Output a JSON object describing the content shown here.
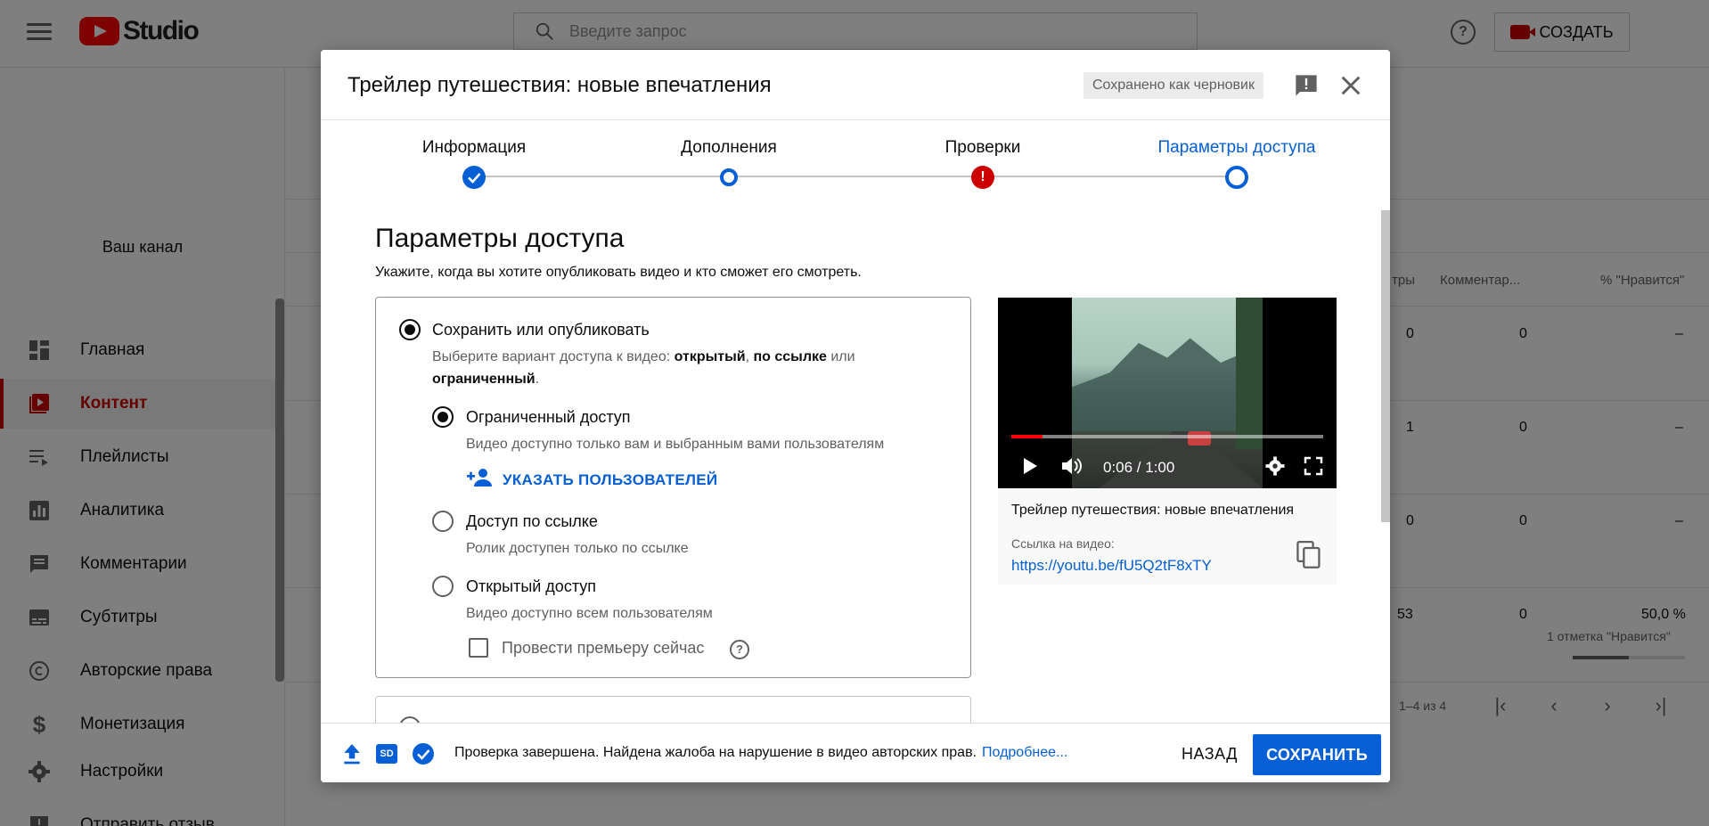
{
  "app": {
    "logo_text": "Studio",
    "search_placeholder": "Введите запрос",
    "create_label": "СОЗДАТЬ",
    "help_glyph": "?"
  },
  "sidebar": {
    "channel_label": "Ваш канал",
    "items": [
      {
        "label": "Главная",
        "icon": "dashboard-icon"
      },
      {
        "label": "Контент",
        "icon": "content-icon",
        "active": true
      },
      {
        "label": "Плейлисты",
        "icon": "playlist-icon"
      },
      {
        "label": "Аналитика",
        "icon": "analytics-icon"
      },
      {
        "label": "Комментарии",
        "icon": "comments-icon"
      },
      {
        "label": "Субтитры",
        "icon": "subtitles-icon"
      },
      {
        "label": "Авторские права",
        "icon": "copyright-icon"
      },
      {
        "label": "Монетизация",
        "icon": "dollar-icon"
      },
      {
        "label": "Настройки",
        "icon": "gear-icon"
      },
      {
        "label": "Отправить отзыв",
        "icon": "feedback-icon"
      }
    ]
  },
  "table": {
    "headers": [
      "тры",
      "Комментар...",
      "% \"Нравится\""
    ],
    "rows": [
      {
        "views": "0",
        "comments": "0",
        "likes": "–"
      },
      {
        "views": "1",
        "comments": "0",
        "likes": "–"
      },
      {
        "views": "0",
        "comments": "0",
        "likes": "–"
      },
      {
        "views": "53",
        "comments": "0",
        "likes": "50,0 %",
        "likes_sub": "1 отметка \"Нравится\"",
        "likes_ratio": 0.5
      }
    ],
    "pager_text": "1–4 из 4"
  },
  "dialog": {
    "title": "Трейлер путешествия: новые впечатления",
    "draft_badge": "Сохранено как черновик",
    "steps": [
      {
        "label": "Информация",
        "state": "done"
      },
      {
        "label": "Дополнения",
        "state": "visited"
      },
      {
        "label": "Проверки",
        "state": "error"
      },
      {
        "label": "Параметры доступа",
        "state": "current"
      }
    ],
    "section_title": "Параметры доступа",
    "section_subtitle": "Укажите, когда вы хотите опубликовать видео и кто сможет его смотреть.",
    "save_publish": {
      "title": "Сохранить или опубликовать",
      "desc_prefix": "Выберите вариант доступа к видео: ",
      "desc_public": "открытый",
      "desc_sep": ", ",
      "desc_link": "по ссылке",
      "desc_or": " или",
      "desc_private": "ограниченный",
      "desc_end": "."
    },
    "options": [
      {
        "title": "Ограниченный доступ",
        "desc": "Видео доступно только вам и выбранным вами пользователям",
        "selected": true
      },
      {
        "title": "Доступ по ссылке",
        "desc": "Ролик доступен только по ссылке",
        "selected": false
      },
      {
        "title": "Открытый доступ",
        "desc": "Видео доступно всем пользователям",
        "selected": false
      }
    ],
    "add_users_label": "УКАЗАТЬ ПОЛЬЗОВАТЕЛЕЙ",
    "premiere_label": "Провести премьеру сейчас",
    "preview": {
      "time": "0:06 / 1:00",
      "progress": 0.1,
      "title": "Трейлер путешествия: новые впечатления",
      "link_label": "Ссылка на видео:",
      "link": "https://youtu.be/fU5Q2tF8xTY"
    },
    "footer": {
      "status_text": "Проверка завершена. Найдена жалоба на нарушение в видео авторских прав.",
      "more_link": "Подробнее...",
      "sd_badge": "SD",
      "back_label": "НАЗАД",
      "save_label": "СОХРАНИТЬ"
    }
  }
}
